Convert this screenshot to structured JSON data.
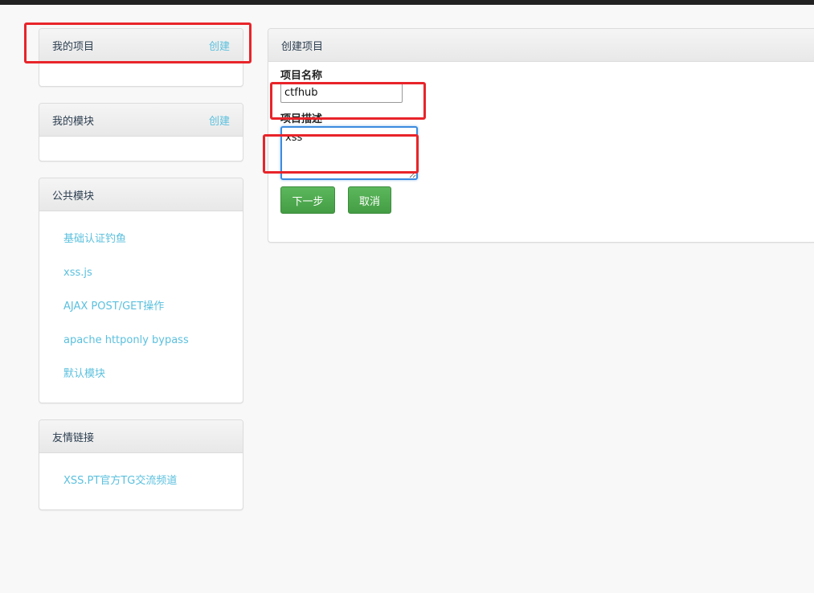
{
  "sidebar": {
    "my_projects": {
      "title": "我的项目",
      "action": "创建"
    },
    "my_modules": {
      "title": "我的模块",
      "action": "创建"
    },
    "public_modules": {
      "title": "公共模块",
      "items": [
        "基础认证钓鱼",
        "xss.js",
        "AJAX POST/GET操作",
        "apache httponly bypass",
        "默认模块"
      ]
    },
    "friend_links": {
      "title": "友情链接",
      "items": [
        "XSS.PT官方TG交流频道"
      ]
    }
  },
  "main": {
    "title": "创建项目",
    "name_label": "项目名称",
    "name_value": "ctfhub",
    "desc_label": "项目描述",
    "desc_value": "xss",
    "next_button": "下一步",
    "cancel_button": "取消"
  },
  "colors": {
    "link": "#5bc0de",
    "button_green": "#5cb85c",
    "annotation_red": "#e8242a",
    "focus_blue": "#3b8be0"
  }
}
